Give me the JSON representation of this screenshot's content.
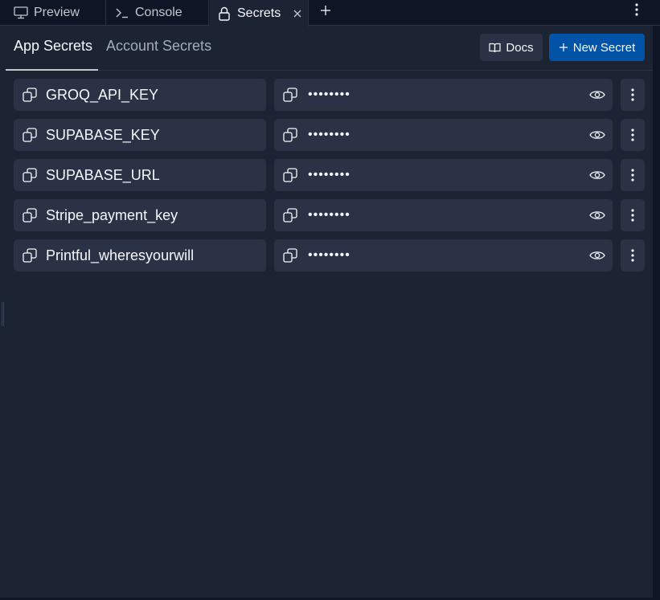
{
  "tabs": [
    {
      "label": "Preview",
      "icon": "monitor-icon"
    },
    {
      "label": "Console",
      "icon": "terminal-icon"
    },
    {
      "label": "Secrets",
      "icon": "lock-icon",
      "active": true
    }
  ],
  "subtabs": [
    {
      "label": "App Secrets",
      "active": true
    },
    {
      "label": "Account Secrets"
    }
  ],
  "toolbar": {
    "docs_label": "Docs",
    "new_secret_label": "New Secret"
  },
  "secrets": [
    {
      "key": "GROQ_API_KEY",
      "value": "••••••••"
    },
    {
      "key": "SUPABASE_KEY",
      "value": "••••••••"
    },
    {
      "key": "SUPABASE_URL",
      "value": "••••••••"
    },
    {
      "key": "Stripe_payment_key",
      "value": "••••••••"
    },
    {
      "key": "Printful_wheresyourwill",
      "value": "••••••••"
    }
  ],
  "colors": {
    "background": "#1c2333",
    "tabbar": "#0e1525",
    "surface": "#2b3245",
    "primary_button": "#0053a6",
    "text": "#f5f9fc",
    "muted_text": "#a3acba"
  }
}
